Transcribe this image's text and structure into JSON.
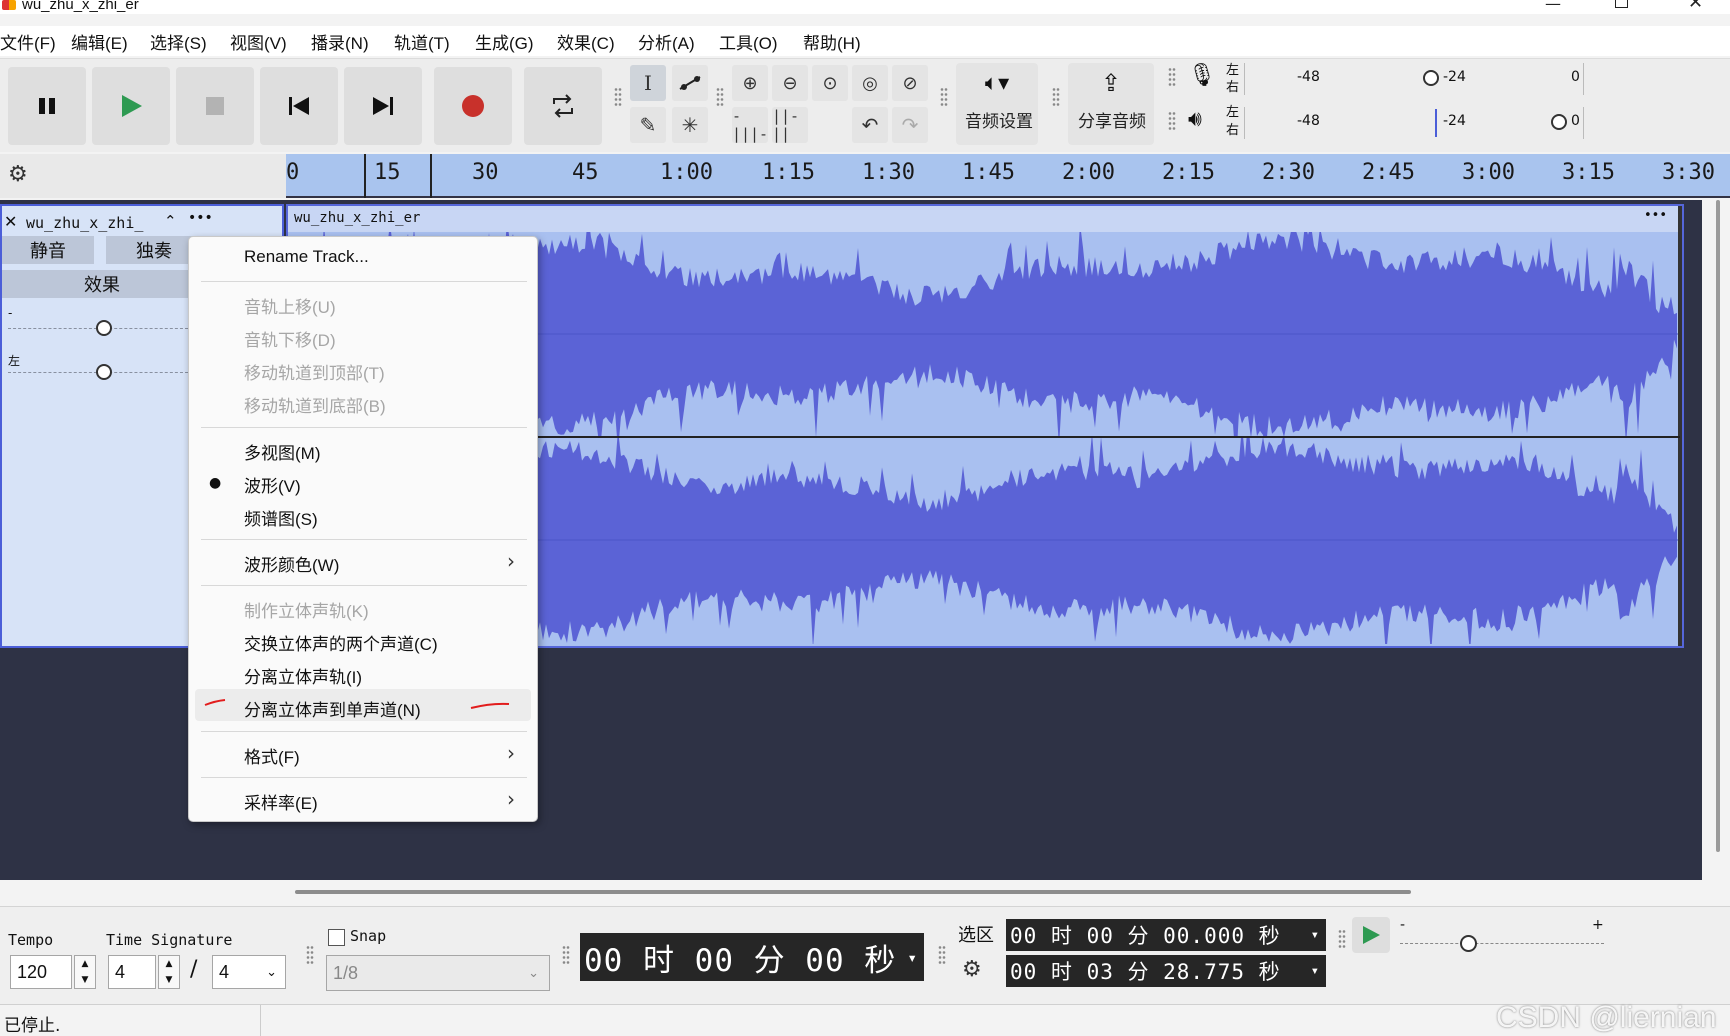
{
  "window": {
    "title": "wu_zhu_x_zhi_er"
  },
  "menu": [
    "文件(F)",
    "编辑(E)",
    "选择(S)",
    "视图(V)",
    "播录(N)",
    "轨道(T)",
    "生成(G)",
    "效果(C)",
    "分析(A)",
    "工具(O)",
    "帮助(H)"
  ],
  "toolbar": {
    "audio_setup": "音频设置",
    "share_audio": "分享音频",
    "rec_meter": {
      "l": "左",
      "r": "右",
      "ticks": [
        "-48",
        "-24",
        "0"
      ]
    },
    "play_meter": {
      "l": "左",
      "r": "右",
      "ticks": [
        "-48",
        "-24",
        "0"
      ]
    }
  },
  "ruler": {
    "labels": [
      "0",
      "15",
      "30",
      "45",
      "1:00",
      "1:15",
      "1:30",
      "1:45",
      "2:00",
      "2:15",
      "2:30",
      "2:45",
      "3:00",
      "3:15",
      "3:30"
    ]
  },
  "track": {
    "name": "wu_zhu_x_zhi_",
    "mute": "静音",
    "solo": "独奏",
    "effects": "效果",
    "gain_minus": "-",
    "pan_left": "左",
    "clip_name": "wu_zhu_x_zhi_er",
    "clip_menu": "•••"
  },
  "context_menu": {
    "rename": "Rename Track...",
    "move_up": "音轨上移(U)",
    "move_down": "音轨下移(D)",
    "move_top": "移动轨道到顶部(T)",
    "move_bottom": "移动轨道到底部(B)",
    "multiview": "多视图(M)",
    "waveform": "波形(V)",
    "spectrogram": "频谱图(S)",
    "wave_color": "波形颜色(W)",
    "make_stereo": "制作立体声轨(K)",
    "swap_channels": "交换立体声的两个声道(C)",
    "split_stereo": "分离立体声轨(I)",
    "split_to_mono": "分离立体声到单声道(N)",
    "format": "格式(F)",
    "rate": "采样率(E)"
  },
  "bottom": {
    "tempo_label": "Tempo",
    "tempo_value": "120",
    "timesig_label": "Time Signature",
    "timesig_num": "4",
    "timesig_slash": "/",
    "timesig_den": "4",
    "snap_label": "Snap",
    "snap_value": "1/8",
    "time_display": "00 时 00 分 00 秒",
    "selection_label": "选区",
    "sel_start": "00 时 00 分 00.000 秒",
    "sel_end": "00 时 03 分 28.775 秒",
    "speed_minus": "-",
    "speed_plus": "+"
  },
  "status": {
    "text": "已停止."
  },
  "watermark": "CSDN @liernian",
  "colors": {
    "ruler": "#a9c4ee",
    "clip": "#a9c0f0",
    "waveform": "#5b63d6",
    "record": "#c8312b",
    "play": "#2e9a52",
    "annotation": "#e21d1d"
  }
}
